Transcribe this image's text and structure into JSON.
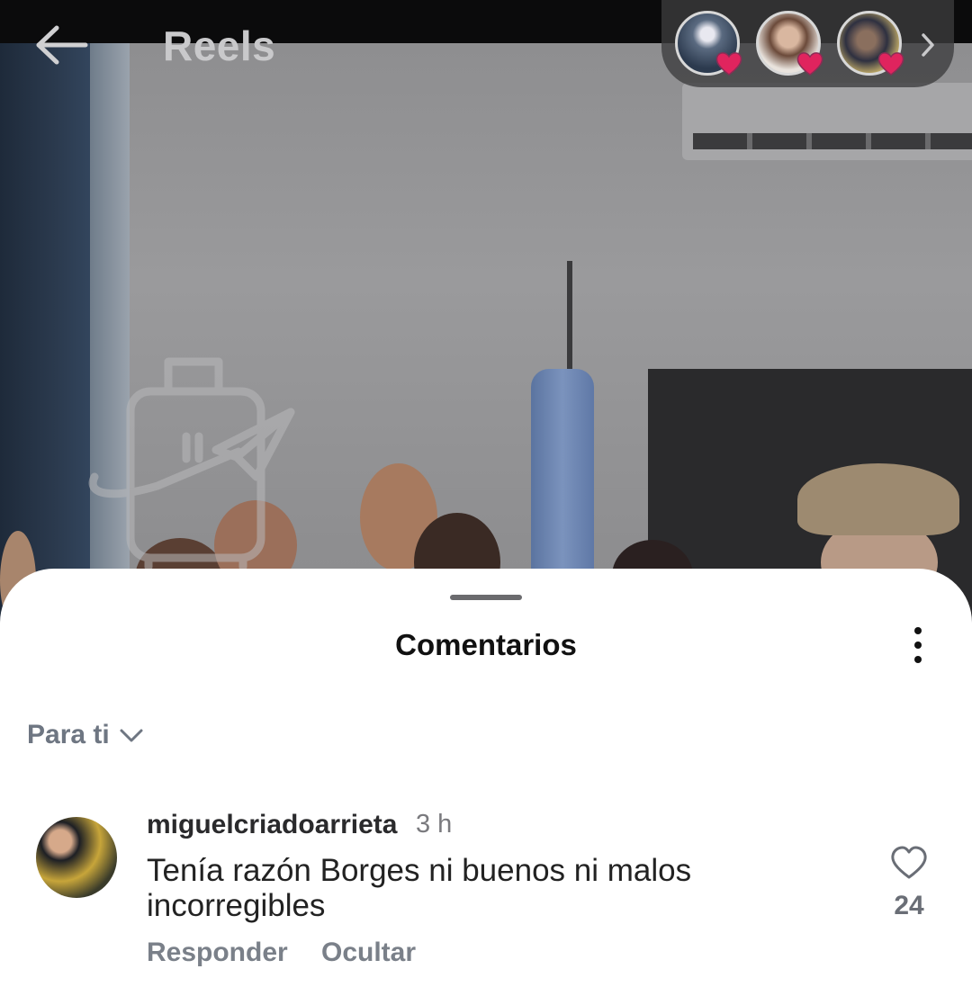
{
  "header": {
    "title": "Reels",
    "back_icon": "arrow-left-icon",
    "stories_chevron_icon": "chevron-right-icon"
  },
  "stories": [
    {
      "name": "story-avatar-1",
      "badge_icon": "heart-icon"
    },
    {
      "name": "story-avatar-2",
      "badge_icon": "heart-icon"
    },
    {
      "name": "story-avatar-3",
      "badge_icon": "heart-icon"
    }
  ],
  "comments_sheet": {
    "title": "Comentarios",
    "more_icon": "more-vertical-icon",
    "sort": {
      "label": "Para ti",
      "icon": "chevron-down-icon"
    }
  },
  "comments": [
    {
      "username": "miguelcriadoarrieta",
      "time": "3 h",
      "text": "Tenía razón Borges ni buenos ni malos incorregibles",
      "reply_label": "Responder",
      "hide_label": "Ocultar",
      "like_count": "24",
      "like_icon": "heart-outline-icon"
    }
  ],
  "colors": {
    "sheet_background": "#ffffff",
    "story_heart": "#e0245e",
    "secondary_text": "#7a8089"
  }
}
